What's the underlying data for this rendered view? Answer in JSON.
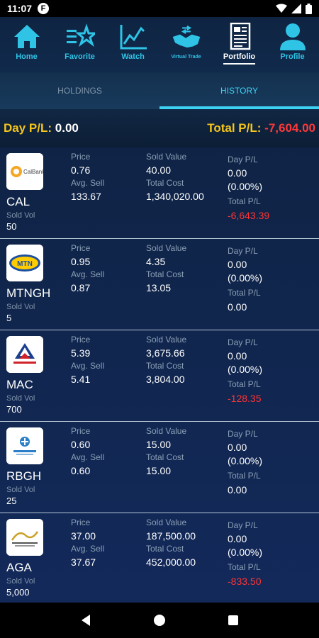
{
  "status": {
    "time": "11:07",
    "f_badge": "F"
  },
  "nav": [
    {
      "label": "Home",
      "icon": "home-icon"
    },
    {
      "label": "Favorite",
      "icon": "favorite-icon"
    },
    {
      "label": "Watch",
      "icon": "watch-chart-icon"
    },
    {
      "label": "Virtual Trade",
      "icon": "handshake-icon"
    },
    {
      "label": "Portfolio",
      "icon": "portfolio-document-icon",
      "active": true
    },
    {
      "label": "Profile",
      "icon": "profile-icon"
    }
  ],
  "tabs": {
    "holdings": "HOLDINGS",
    "history": "HISTORY",
    "active": "history"
  },
  "pl": {
    "day_label": "Day P/L:",
    "day_value": "0.00",
    "total_label": "Total P/L:",
    "total_value": "-7,604.00"
  },
  "labels": {
    "price": "Price",
    "avg_sell": "Avg. Sell",
    "sold_value": "Sold Value",
    "total_cost": "Total Cost",
    "day_pl": "Day P/L",
    "total_pl": "Total P/L",
    "sold_vol": "Sold Vol"
  },
  "rows": [
    {
      "symbol": "CAL",
      "sold_vol": "50",
      "price": "0.76",
      "avg_sell": "133.67",
      "sold_value": "40.00",
      "total_cost": "1,340,020.00",
      "day_pl": "0.00",
      "day_pl_pct": "(0.00%)",
      "total_pl": "-6,643.39",
      "total_pl_negative": true
    },
    {
      "symbol": "MTNGH",
      "sold_vol": "5",
      "price": "0.95",
      "avg_sell": "0.87",
      "sold_value": "4.35",
      "total_cost": "13.05",
      "day_pl": "0.00",
      "day_pl_pct": "(0.00%)",
      "total_pl": "0.00",
      "total_pl_negative": false
    },
    {
      "symbol": "MAC",
      "sold_vol": "700",
      "price": "5.39",
      "avg_sell": "5.41",
      "sold_value": "3,675.66",
      "total_cost": "3,804.00",
      "day_pl": "0.00",
      "day_pl_pct": "(0.00%)",
      "total_pl": "-128.35",
      "total_pl_negative": true
    },
    {
      "symbol": "RBGH",
      "sold_vol": "25",
      "price": "0.60",
      "avg_sell": "0.60",
      "sold_value": "15.00",
      "total_cost": "15.00",
      "day_pl": "0.00",
      "day_pl_pct": "(0.00%)",
      "total_pl": "0.00",
      "total_pl_negative": false
    },
    {
      "symbol": "AGA",
      "sold_vol": "5,000",
      "price": "37.00",
      "avg_sell": "37.67",
      "sold_value": "187,500.00",
      "total_cost": "452,000.00",
      "day_pl": "0.00",
      "day_pl_pct": "(0.00%)",
      "total_pl": "-833.50",
      "total_pl_negative": true
    }
  ],
  "logos": {
    "cal_text": "CalBank",
    "mtn_text": "MTN"
  },
  "colors": {
    "accent": "#2fc3e6",
    "negative": "#ff3333",
    "highlight": "#f5c51b"
  }
}
